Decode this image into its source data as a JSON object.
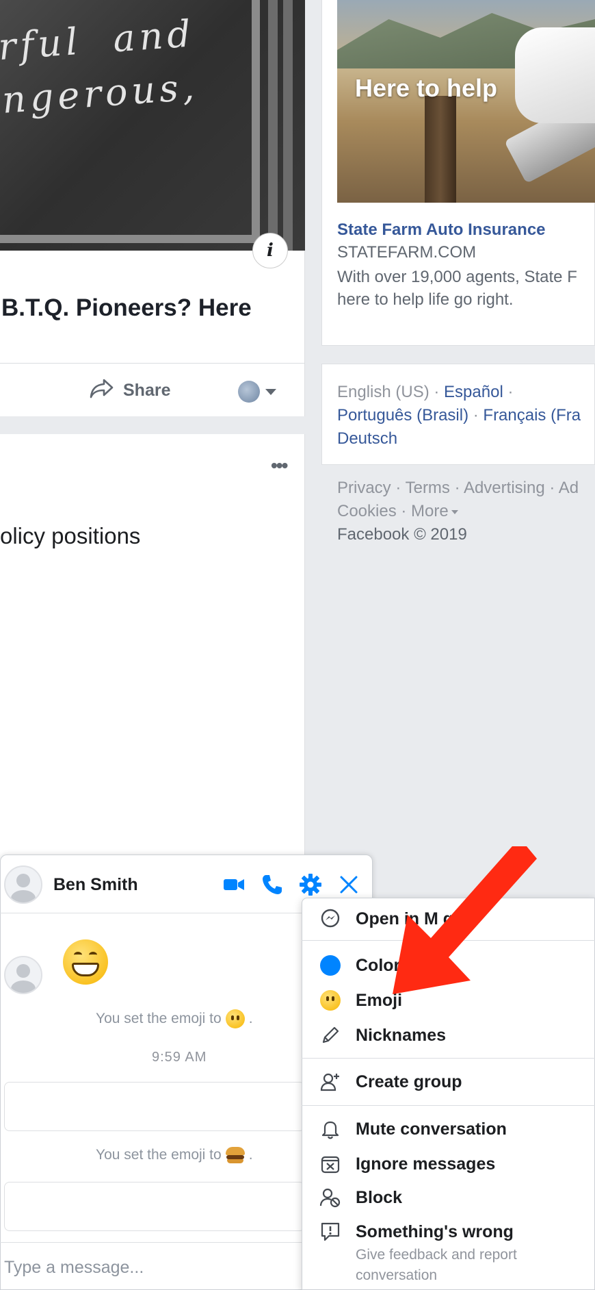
{
  "feed": {
    "photo_chalk_text": "rful  and\nngerous,",
    "post_headline": "B.T.Q. Pioneers? Here",
    "share_label": "Share",
    "post2_text": "olicy positions",
    "more_label": "•••"
  },
  "ad": {
    "image_caption": "Here to help",
    "title": "State Farm Auto Insurance",
    "domain": "STATEFARM.COM",
    "description": "With over 19,000 agents, State F here to help life go right."
  },
  "languages": {
    "current": "English (US)",
    "links": [
      "Español",
      "Português (Brasil)",
      "Français (Fra",
      "Deutsch"
    ]
  },
  "footer": {
    "links": [
      "Privacy",
      "Terms",
      "Advertising",
      "Ad",
      "Cookies",
      "More"
    ],
    "copyright": "Facebook © 2019"
  },
  "chat": {
    "contact_name": "Ben Smith",
    "sys_msg_1": "You set the emoji to",
    "sys_msg_2": "You set the emoji to",
    "timestamp": "9:59 AM",
    "compose_placeholder": "Type a message..."
  },
  "menu": {
    "items": [
      {
        "label": "Open in Messenger",
        "icon": "messenger-icon"
      },
      {
        "label": "Color",
        "icon": "color-dot-icon"
      },
      {
        "label": "Emoji",
        "icon": "emoji-icon"
      },
      {
        "label": "Nicknames",
        "icon": "pencil-icon"
      },
      {
        "label": "Create group",
        "icon": "add-person-icon"
      },
      {
        "label": "Mute conversation",
        "icon": "bell-icon"
      },
      {
        "label": "Ignore messages",
        "icon": "ignore-icon"
      },
      {
        "label": "Block",
        "icon": "block-user-icon"
      },
      {
        "label": "Something's wrong",
        "icon": "feedback-icon"
      }
    ],
    "feedback_sub": "Give feedback and report conversation",
    "open_messenger_visible": "Open in M      ger"
  },
  "colors": {
    "link_blue": "#365899",
    "messenger_blue": "#0084ff",
    "annotation_red": "#ff2a12"
  }
}
